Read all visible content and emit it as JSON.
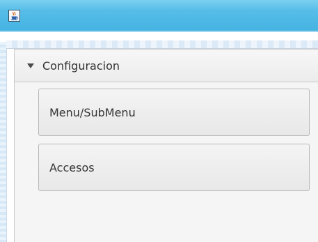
{
  "window": {
    "title": "",
    "icon": "java-icon"
  },
  "pane": {
    "title": "Configuracion",
    "expanded": true,
    "items": [
      {
        "label": "Menu/SubMenu"
      },
      {
        "label": "Accesos"
      }
    ]
  },
  "colors": {
    "titlebar": "#45b3e2",
    "pane_background": "#f5f5f5",
    "button_border": "#b9b9b9",
    "text": "#333333"
  }
}
